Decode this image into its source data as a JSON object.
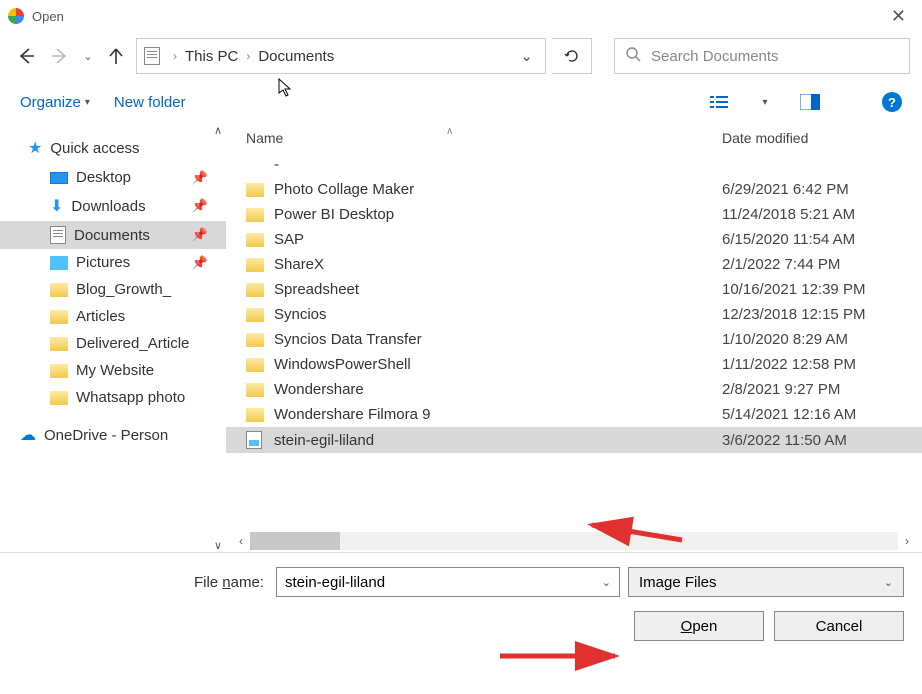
{
  "title": "Open",
  "breadcrumb": {
    "pc": "This PC",
    "folder": "Documents"
  },
  "search": {
    "placeholder": "Search Documents"
  },
  "toolbar": {
    "organize": "Organize",
    "newfolder": "New folder"
  },
  "sidebar": {
    "quick": "Quick access",
    "items": [
      {
        "label": "Desktop",
        "icon": "desktop",
        "pinned": true
      },
      {
        "label": "Downloads",
        "icon": "download",
        "pinned": true
      },
      {
        "label": "Documents",
        "icon": "docfile",
        "pinned": true,
        "selected": true
      },
      {
        "label": "Pictures",
        "icon": "pictures",
        "pinned": true
      },
      {
        "label": "Blog_Growth_",
        "icon": "folder"
      },
      {
        "label": "Articles",
        "icon": "folder"
      },
      {
        "label": "Delivered_Article",
        "icon": "folder"
      },
      {
        "label": "My Website",
        "icon": "folder"
      },
      {
        "label": "Whatsapp photo",
        "icon": "folder"
      }
    ],
    "onedrive": "OneDrive - Person"
  },
  "columns": {
    "name": "Name",
    "date": "Date modified"
  },
  "files": [
    {
      "name": "-",
      "date": "",
      "type": "blank"
    },
    {
      "name": "Photo Collage Maker",
      "date": "6/29/2021 6:42 PM",
      "type": "folder"
    },
    {
      "name": "Power BI Desktop",
      "date": "11/24/2018 5:21 AM",
      "type": "folder"
    },
    {
      "name": "SAP",
      "date": "6/15/2020 11:54 AM",
      "type": "folder"
    },
    {
      "name": "ShareX",
      "date": "2/1/2022 7:44 PM",
      "type": "folder"
    },
    {
      "name": "Spreadsheet",
      "date": "10/16/2021 12:39 PM",
      "type": "folder"
    },
    {
      "name": "Syncios",
      "date": "12/23/2018 12:15 PM",
      "type": "folder"
    },
    {
      "name": "Syncios Data Transfer",
      "date": "1/10/2020 8:29 AM",
      "type": "folder"
    },
    {
      "name": "WindowsPowerShell",
      "date": "1/11/2022 12:58 PM",
      "type": "folder"
    },
    {
      "name": "Wondershare",
      "date": "2/8/2021 9:27 PM",
      "type": "folder"
    },
    {
      "name": "Wondershare Filmora 9",
      "date": "5/14/2021 12:16 AM",
      "type": "folder"
    },
    {
      "name": "stein-egil-liland",
      "date": "3/6/2022 11:50 AM",
      "type": "image",
      "selected": true
    }
  ],
  "filename": {
    "label_pre": "File ",
    "label_u": "n",
    "label_post": "ame:",
    "value": "stein-egil-liland"
  },
  "filter": "Image Files",
  "buttons": {
    "open_u": "O",
    "open_post": "pen",
    "cancel": "Cancel"
  }
}
